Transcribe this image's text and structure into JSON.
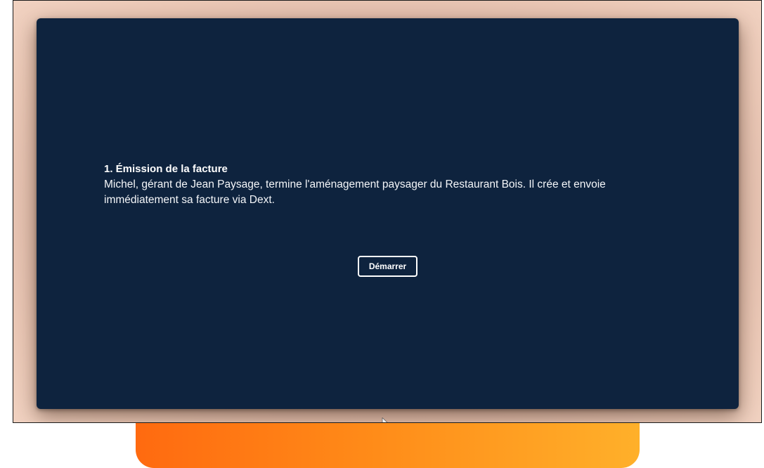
{
  "colors": {
    "panel_background": "#0e233e",
    "accent_orange_start": "#ff6a10",
    "accent_orange_end": "#ffb02a",
    "text": "#ffffff"
  },
  "step": {
    "title": "1. Émission de la facture",
    "description": "Michel, gérant de Jean Paysage, termine l'aménagement paysager du Restaurant Bois. Il crée et envoie immédiatement sa facture via Dext."
  },
  "start_button": {
    "label": "Démarrer"
  },
  "icons": {
    "cursor": "mouse-pointer-icon"
  }
}
